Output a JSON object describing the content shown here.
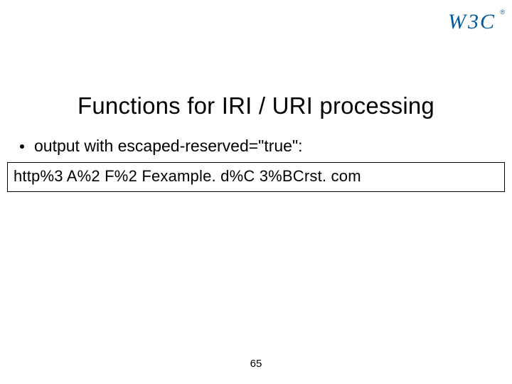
{
  "logo": {
    "text": "W3C",
    "registered": "®"
  },
  "title": "Functions for IRI / URI processing",
  "bullet": "output with escaped-reserved=\"true\":",
  "code": "http%3 A%2 F%2 Fexample. d%C 3%BCrst. com",
  "page_number": "65"
}
